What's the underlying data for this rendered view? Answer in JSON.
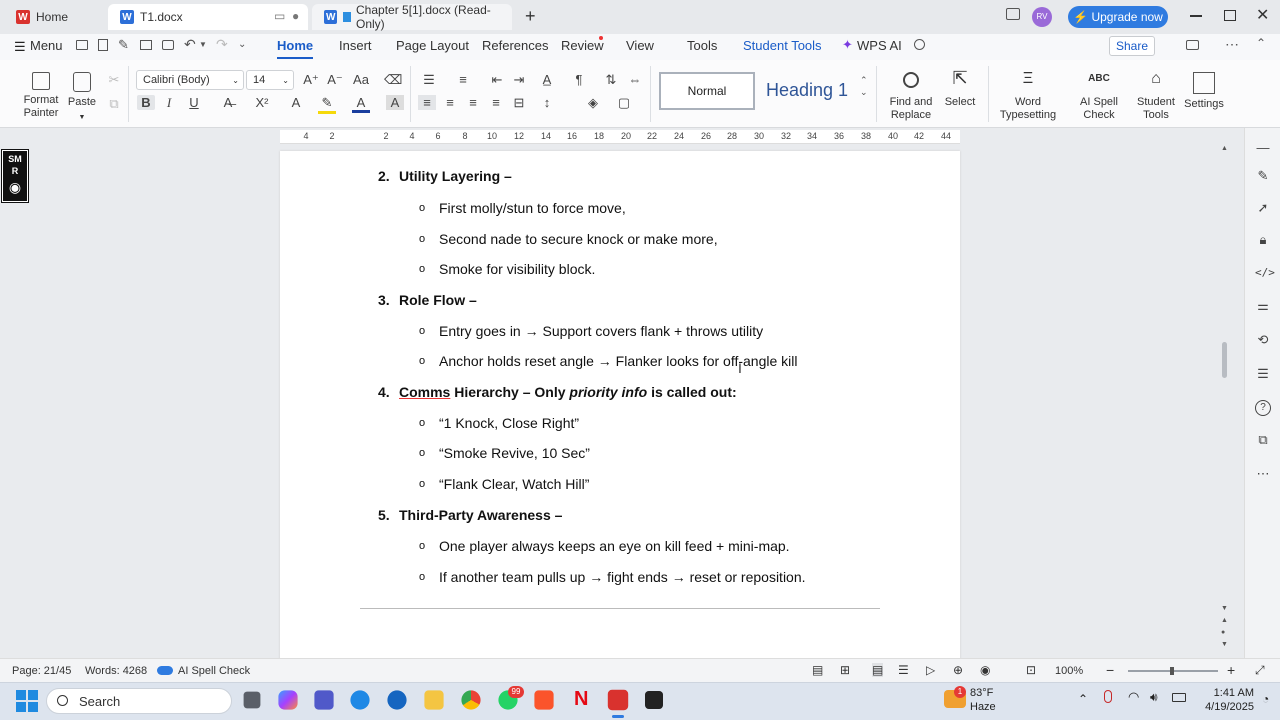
{
  "tabs": [
    {
      "label": "Home"
    },
    {
      "label": "T1.docx"
    },
    {
      "label": "Chapter 5[1].docx (Read-Only)"
    }
  ],
  "account": {
    "initials": "RV",
    "upgrade_label": "Upgrade now"
  },
  "menu": {
    "menu_label": "Menu",
    "items": [
      "Home",
      "Insert",
      "Page Layout",
      "References",
      "Review",
      "View",
      "Tools",
      "Student Tools",
      "WPS AI"
    ],
    "share_label": "Share"
  },
  "ribbon": {
    "format_painter": "Format Painter",
    "paste": "Paste",
    "font_name": "Calibri (Body)",
    "font_size": "14",
    "style_normal": "Normal",
    "style_heading": "Heading 1",
    "find_replace": "Find and Replace",
    "select": "Select",
    "word_typesetting": "Word Typesetting",
    "ai_spell": "AI Spell Check",
    "student_tools": "Student Tools",
    "settings": "Settings"
  },
  "ruler": {
    "ticks": [
      "4",
      "2",
      "2",
      "4",
      "6",
      "8",
      "10",
      "12",
      "14",
      "16",
      "18",
      "20",
      "22",
      "24",
      "26",
      "28",
      "30",
      "32",
      "34",
      "36",
      "38",
      "40",
      "42",
      "44"
    ]
  },
  "document": {
    "items": [
      {
        "num": "2.",
        "title": "Utility Layering –",
        "bullets": [
          "First molly/stun to force move,",
          "Second nade to secure knock or make more,",
          "Smoke for visibility block."
        ]
      },
      {
        "num": "3.",
        "title": "Role Flow –",
        "bullets": [
          "Entry goes in → Support covers flank + throws utility",
          "Anchor holds reset angle → Flanker looks for off-angle kill"
        ]
      },
      {
        "num": "4.",
        "title_a": "Comms",
        "title_b": " Hierarchy – Only ",
        "title_c": "priority info",
        "title_d": " is called out:",
        "bullets": [
          "“1 Knock, Close Right”",
          "“Smoke Revive, 10 Sec”",
          "“Flank Clear, Watch Hill”"
        ]
      },
      {
        "num": "5.",
        "title": "Third-Party Awareness –",
        "bullets": [
          "One player always keeps an eye on kill feed + mini-map.",
          "If another team pulls up → fight ends → reset or reposition."
        ]
      }
    ]
  },
  "status": {
    "page": "Page: 21/45",
    "words": "Words: 4268",
    "spell": "AI Spell Check",
    "zoom": "100%"
  },
  "taskbar": {
    "search": "Search",
    "weather_temp": "83°F",
    "weather_desc": "Haze",
    "time": "1:41 AM",
    "date": "4/19/2025",
    "weather_badge": "1",
    "whatsapp_badge": "99"
  },
  "colors": {
    "accent": "#1a5cc8",
    "wps_red": "#d9322e"
  }
}
